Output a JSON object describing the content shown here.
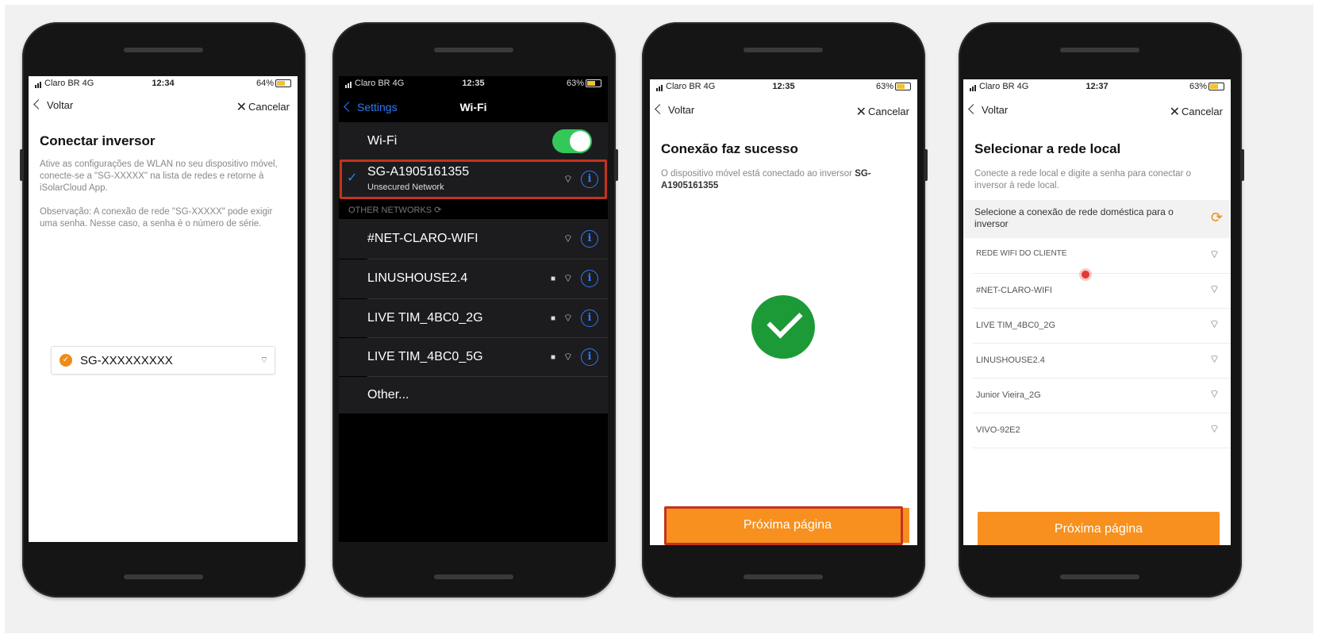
{
  "colors": {
    "accent_orange": "#f7901e",
    "success_green": "#1b9a37",
    "ios_blue": "#2f7bf5",
    "toggle_green": "#34c759",
    "highlight_red": "#c2331f"
  },
  "phone1": {
    "status": {
      "carrier": "Claro BR 4G",
      "time": "12:34",
      "battery": "64%"
    },
    "nav": {
      "back": "Voltar",
      "cancel": "Cancelar"
    },
    "title": "Conectar inversor",
    "instructions": "Ative as configurações de WLAN no seu dispositivo móvel, conecte-se a \"SG-XXXXX\" na lista de redes e retorne à iSolarCloud App.",
    "note": "Observação: A conexão de rede \"SG-XXXXX\" pode exigir uma senha. Nesse caso, a senha é o número de série.",
    "device": {
      "name": "SG-XXXXXXXXX",
      "icon": "wifi-icon"
    }
  },
  "phone2": {
    "status": {
      "carrier": "Claro BR 4G",
      "time": "12:35",
      "battery": "63%"
    },
    "nav": {
      "back": "Settings",
      "title": "Wi-Fi"
    },
    "wifi_label": "Wi-Fi",
    "wifi_enabled": true,
    "connected": {
      "name": "SG-A1905161355",
      "sub": "Unsecured Network"
    },
    "section_header": "OTHER NETWORKS",
    "networks": [
      {
        "name": "#NET-CLARO-WIFI",
        "locked": false
      },
      {
        "name": "LINUSHOUSE2.4",
        "locked": true
      },
      {
        "name": "LIVE TIM_4BC0_2G",
        "locked": true
      },
      {
        "name": "LIVE TIM_4BC0_5G",
        "locked": true
      }
    ],
    "other": "Other..."
  },
  "phone3": {
    "status": {
      "carrier": "Claro BR 4G",
      "time": "12:35",
      "battery": "63%"
    },
    "nav": {
      "back": "Voltar",
      "cancel": "Cancelar"
    },
    "title": "Conexão faz sucesso",
    "message": "O dispositivo móvel está conectado ao inversor ",
    "device": "SG-A1905161355",
    "button": "Próxima página"
  },
  "phone4": {
    "status": {
      "carrier": "Claro BR 4G",
      "time": "12:37",
      "battery": "63%"
    },
    "nav": {
      "back": "Voltar",
      "cancel": "Cancelar"
    },
    "title": "Selecionar a rede local",
    "instructions": "Conecte a rede local e digite a senha para conectar o inversor à rede local.",
    "select_label": "Selecione a conexão de rede doméstica para o inversor",
    "networks": [
      "REDE WIFI DO CLIENTE",
      "#NET-CLARO-WIFI",
      "LIVE TIM_4BC0_2G",
      "LINUSHOUSE2.4",
      "Junior Vieira_2G",
      "VIVO-92E2"
    ],
    "button": "Próxima página"
  }
}
